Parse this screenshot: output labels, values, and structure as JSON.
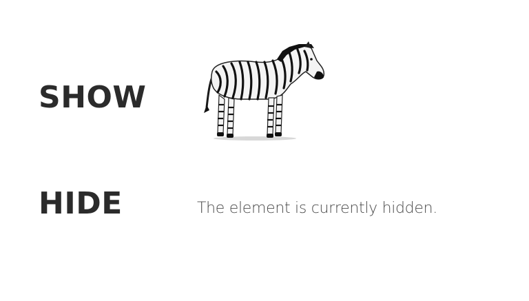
{
  "controls": {
    "show_label": "SHOW",
    "hide_label": "HIDE"
  },
  "content": {
    "hidden_message": "The element is currently hidden."
  },
  "image": {
    "subject": "zebra"
  },
  "colors": {
    "background": "#ffffff",
    "label_text": "#2b2b2b",
    "message_text": "#4a4a4a"
  }
}
